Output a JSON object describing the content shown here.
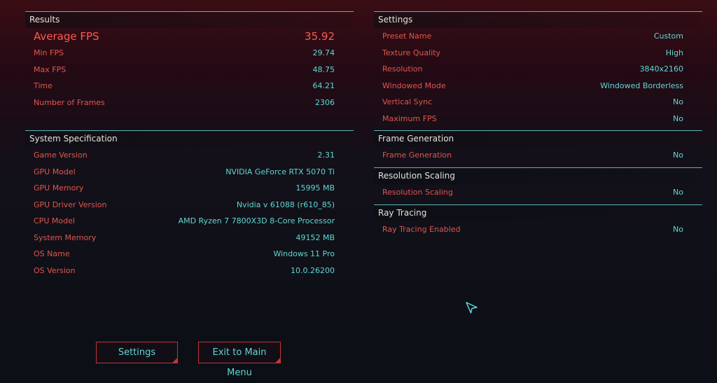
{
  "results": {
    "header": "Results",
    "rows": [
      {
        "label": "Average FPS",
        "value": "35.92"
      },
      {
        "label": "Min FPS",
        "value": "29.74"
      },
      {
        "label": "Max FPS",
        "value": "48.75"
      },
      {
        "label": "Time",
        "value": "64.21"
      },
      {
        "label": "Number of Frames",
        "value": "2306"
      }
    ]
  },
  "system": {
    "header": "System Specification",
    "rows": [
      {
        "label": "Game Version",
        "value": "2.31"
      },
      {
        "label": "GPU Model",
        "value": "NVIDIA GeForce RTX 5070 Ti"
      },
      {
        "label": "GPU Memory",
        "value": "15995 MB"
      },
      {
        "label": "GPU Driver Version",
        "value": "Nvidia v 61088 (r610_85)"
      },
      {
        "label": "CPU Model",
        "value": "AMD Ryzen 7 7800X3D 8-Core Processor"
      },
      {
        "label": "System Memory",
        "value": "49152 MB"
      },
      {
        "label": "OS Name",
        "value": "Windows 11 Pro"
      },
      {
        "label": "OS Version",
        "value": "10.0.26200"
      }
    ]
  },
  "settings": {
    "header": "Settings",
    "rows": [
      {
        "label": "Preset Name",
        "value": "Custom"
      },
      {
        "label": "Texture Quality",
        "value": "High"
      },
      {
        "label": "Resolution",
        "value": "3840x2160"
      },
      {
        "label": "Windowed Mode",
        "value": "Windowed Borderless"
      },
      {
        "label": "Vertical Sync",
        "value": "No"
      },
      {
        "label": "Maximum FPS",
        "value": "No"
      }
    ]
  },
  "frame_generation": {
    "header": "Frame Generation",
    "rows": [
      {
        "label": "Frame Generation",
        "value": "No"
      }
    ]
  },
  "resolution_scaling": {
    "header": "Resolution Scaling",
    "rows": [
      {
        "label": "Resolution Scaling",
        "value": "No"
      }
    ]
  },
  "ray_tracing": {
    "header": "Ray Tracing",
    "rows": [
      {
        "label": "Ray Tracing Enabled",
        "value": "No"
      }
    ]
  },
  "buttons": {
    "settings": "Settings",
    "exit": "Exit to Main Menu"
  },
  "colors": {
    "accent_line": "#5bb5b6",
    "label_red": "#e2564f",
    "value_cyan": "#5fd8d6",
    "button_border": "#c0353a"
  },
  "icons": {
    "cursor": "pointer-arrow-icon"
  }
}
